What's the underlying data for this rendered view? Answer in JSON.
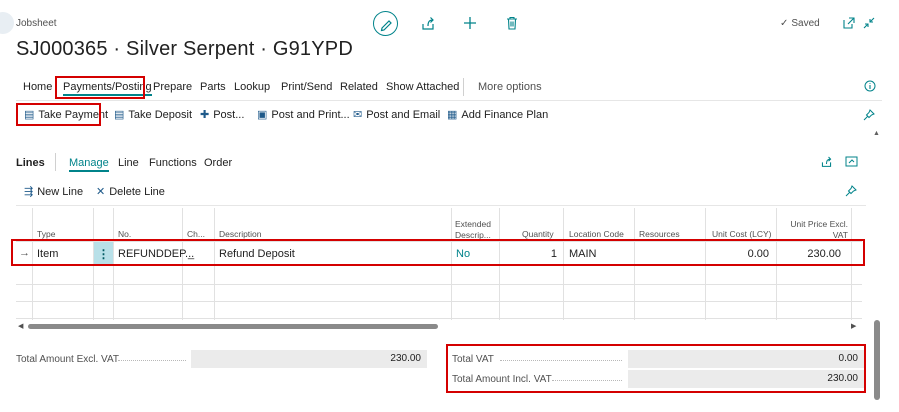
{
  "header": {
    "breadcrumb": "Jobsheet",
    "title": "SJ000365 · Silver Serpent · G91YPD",
    "saved_label": "Saved"
  },
  "tabs": [
    "Home",
    "Payments/Posting",
    "Prepare",
    "Parts",
    "Lookup",
    "Print/Send",
    "Related",
    "Show Attached",
    "More options"
  ],
  "actions": {
    "take_payment": "Take Payment",
    "take_deposit": "Take Deposit",
    "post": "Post...",
    "post_and_print": "Post and Print...",
    "post_and_email": "Post and Email",
    "add_finance_plan": "Add Finance Plan"
  },
  "lines": {
    "title": "Lines",
    "tabs": [
      "Manage",
      "Line",
      "Functions",
      "Order"
    ],
    "new_line": "New Line",
    "delete_line": "Delete Line",
    "columns": {
      "type": "Type",
      "no": "No.",
      "ch": "Ch...",
      "description": "Description",
      "extended_1": "Extended",
      "extended_2": "Descrip...",
      "quantity": "Quantity",
      "location_code": "Location Code",
      "resources": "Resources",
      "unit_cost": "Unit Cost (LCY)",
      "unit_price_1": "Unit Price Excl.",
      "unit_price_2": "VAT"
    },
    "row": {
      "type": "Item",
      "no": "REFUNDDEP...",
      "ch": "_",
      "description": "Refund Deposit",
      "extended": "No",
      "quantity": "1",
      "location_code": "MAIN",
      "resources": "",
      "unit_cost": "0.00",
      "unit_price": "230.00"
    }
  },
  "totals": {
    "excl_label": "Total Amount Excl. VAT",
    "excl_value": "230.00",
    "vat_label": "Total VAT",
    "vat_value": "0.00",
    "incl_label": "Total Amount Incl. VAT",
    "incl_value": "230.00"
  },
  "colors": {
    "accent": "#00838a",
    "highlight": "#d40000"
  }
}
